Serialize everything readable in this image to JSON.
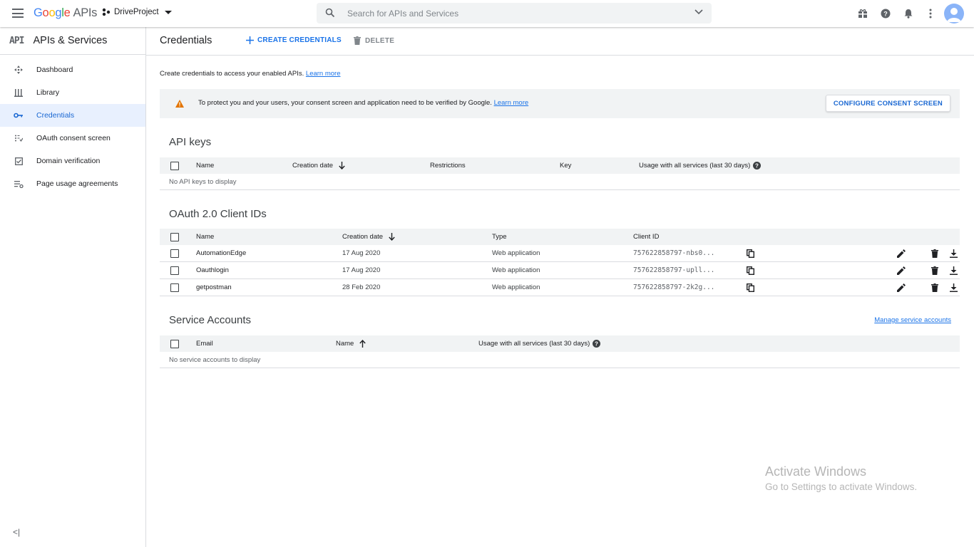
{
  "topbar": {
    "logo": {
      "google": "Google",
      "apis": "APIs"
    },
    "project": "DriveProject",
    "search_placeholder": "Search for APIs and Services",
    "icons": [
      "gift-icon",
      "help-icon",
      "notifications-icon",
      "more-vert-icon",
      "account-avatar"
    ]
  },
  "sidebar": {
    "api_badge": "API",
    "title": "APIs & Services",
    "items": [
      {
        "label": "Dashboard",
        "icon": "dashboard-icon"
      },
      {
        "label": "Library",
        "icon": "library-icon"
      },
      {
        "label": "Credentials",
        "icon": "key-icon",
        "active": true
      },
      {
        "label": "OAuth consent screen",
        "icon": "consent-icon"
      },
      {
        "label": "Domain verification",
        "icon": "checkbox-icon"
      },
      {
        "label": "Page usage agreements",
        "icon": "settings-list-icon"
      }
    ],
    "collapse_label": "<|"
  },
  "main": {
    "title": "Credentials",
    "create_label": "CREATE CREDENTIALS",
    "delete_label": "DELETE",
    "intro_text": "Create credentials to access your enabled APIs.",
    "intro_link": "Learn more",
    "banner": {
      "text": "To protect you and your users, your consent screen and application need to be verified by Google.",
      "link": "Learn more",
      "button": "CONFIGURE CONSENT SCREEN"
    },
    "api_keys": {
      "title": "API keys",
      "columns": [
        "Name",
        "Creation date",
        "Restrictions",
        "Key",
        "Usage with all services (last 30 days)"
      ],
      "empty": "No API keys to display"
    },
    "oauth": {
      "title": "OAuth 2.0 Client IDs",
      "columns": [
        "Name",
        "Creation date",
        "Type",
        "Client ID"
      ],
      "rows": [
        {
          "name": "AutomationEdge",
          "date": "17 Aug 2020",
          "type": "Web application",
          "client_id": "757622858797-nbs0..."
        },
        {
          "name": "Oauthlogin",
          "date": "17 Aug 2020",
          "type": "Web application",
          "client_id": "757622858797-upll..."
        },
        {
          "name": "getpostman",
          "date": "28 Feb 2020",
          "type": "Web application",
          "client_id": "757622858797-2k2g..."
        }
      ]
    },
    "service_accounts": {
      "title": "Service Accounts",
      "manage_link": "Manage service accounts",
      "columns": [
        "Email",
        "Name",
        "Usage with all services (last 30 days)"
      ],
      "empty": "No service accounts to display"
    }
  },
  "watermark": {
    "line1": "Activate Windows",
    "line2": "Go to Settings to activate Windows."
  },
  "colors": {
    "accent": "#1a73e8",
    "active_bg": "#e8f0fe",
    "warning": "#e37400",
    "header_bg": "#f1f3f4"
  }
}
